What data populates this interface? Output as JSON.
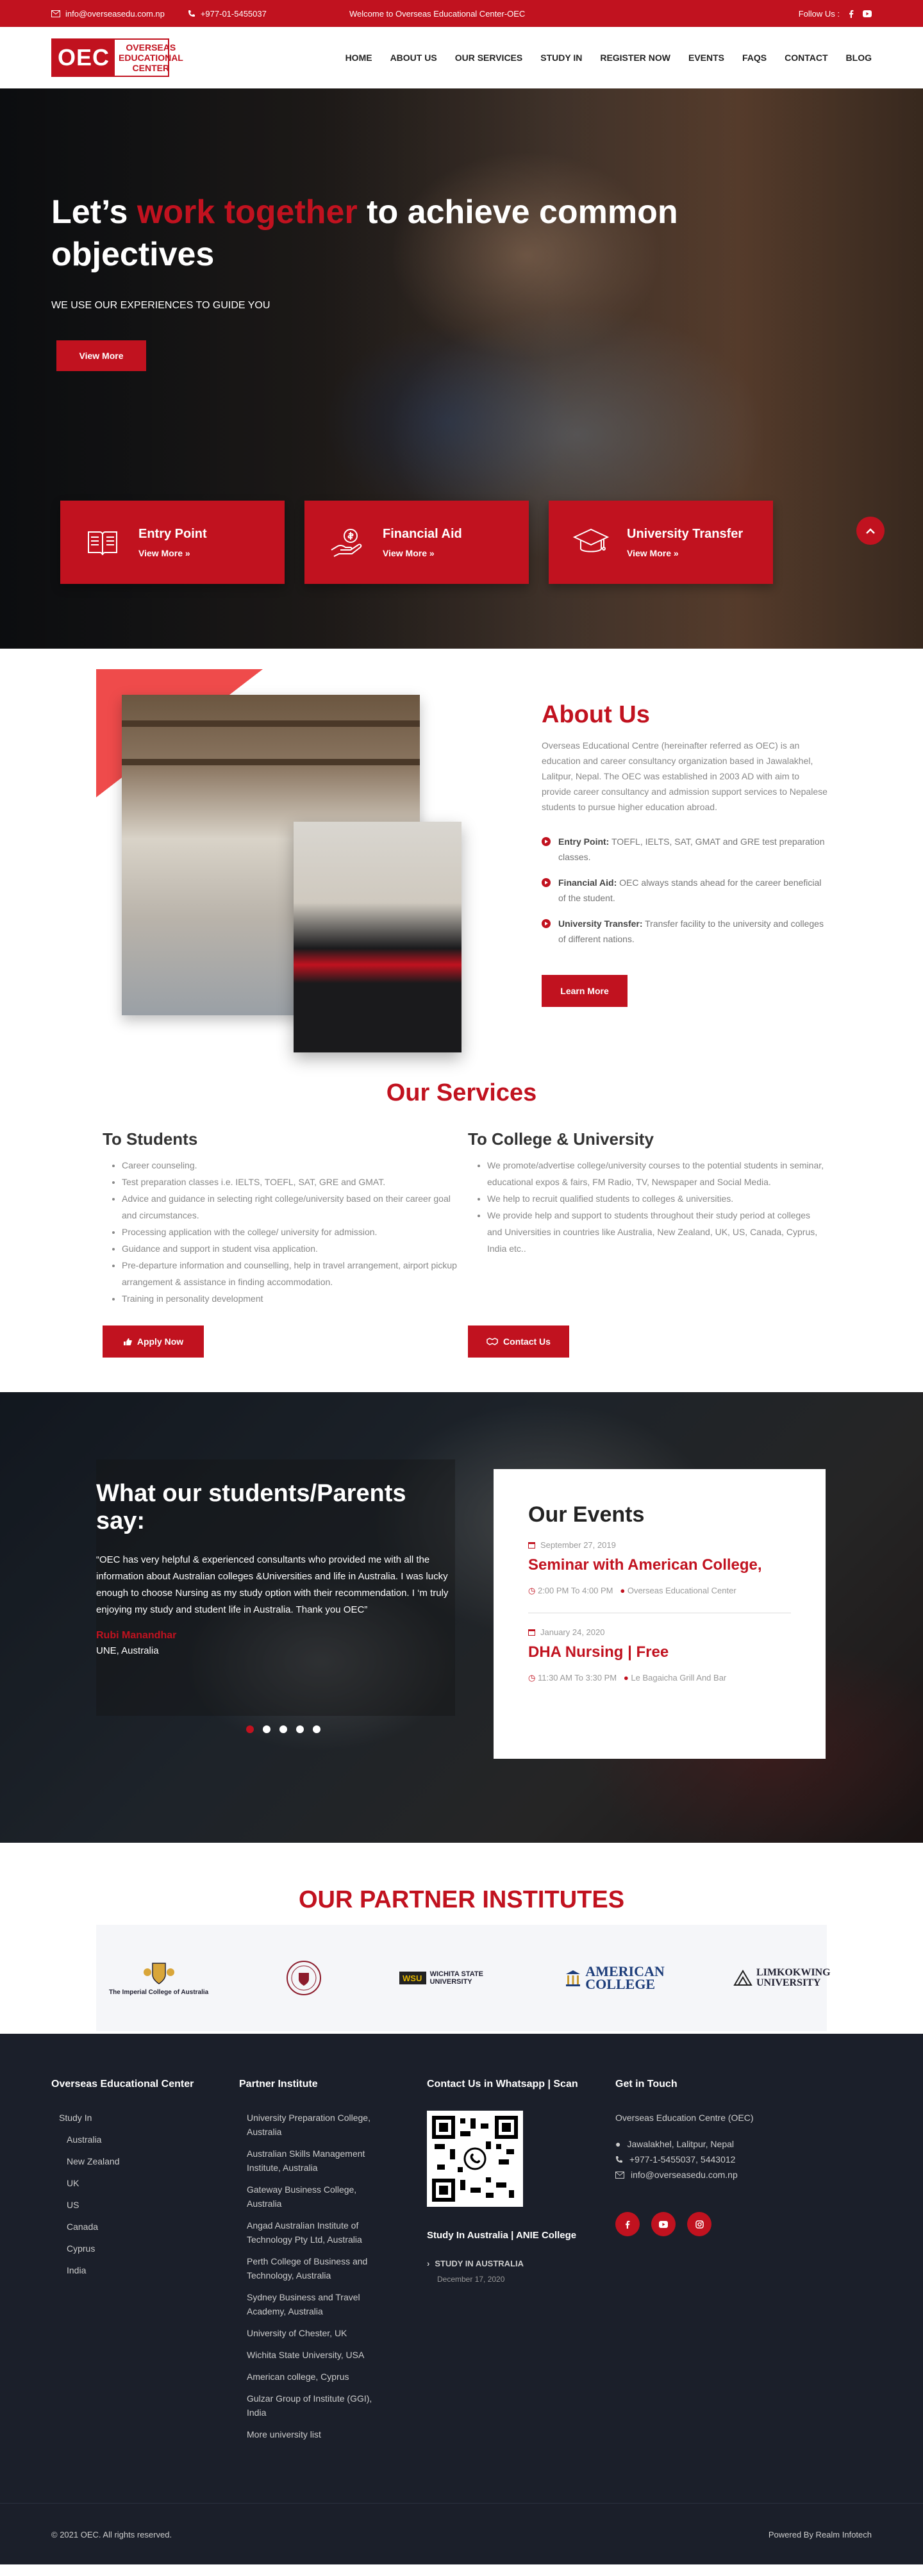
{
  "topbar": {
    "email": "info@overseasedu.com.np",
    "phone": "+977-01-5455037",
    "welcome": "Welcome to Overseas Educational Center-OEC",
    "follow": "Follow Us :"
  },
  "header": {
    "logo_short": "OEC",
    "logo_name": "OVERSEAS EDUCATIONAL CENTER",
    "nav": [
      "HOME",
      "ABOUT US",
      "OUR SERVICES",
      "STUDY IN",
      "REGISTER NOW",
      "EVENTS",
      "FAQS",
      "CONTACT",
      "BLOG"
    ]
  },
  "hero": {
    "title_pre": "Let’s ",
    "title_red": "work together",
    "title_post": " to achieve common objectives",
    "subtitle": "WE USE OUR EXPERIENCES TO GUIDE YOU",
    "button": "View More",
    "features": [
      {
        "title": "Entry Point",
        "more": "View More »",
        "icon": "book-icon"
      },
      {
        "title": "Financial Aid",
        "more": "View More »",
        "icon": "money-hand-icon"
      },
      {
        "title": "University Transfer",
        "more": "View More »",
        "icon": "graduation-cap-icon"
      }
    ]
  },
  "about": {
    "title": "About Us",
    "text": "Overseas Educational Centre (hereinafter referred as OEC) is an education and career consultancy organization based in Jawalakhel, Lalitpur, Nepal. The OEC was established in 2003 AD with aim to provide career consultancy and admission support services to Nepalese students to pursue higher education abroad.",
    "items": [
      {
        "label": "Entry Point:",
        "text": " TOEFL, IELTS, SAT, GMAT and GRE test preparation classes."
      },
      {
        "label": "Financial Aid:",
        "text": " OEC always stands ahead for the career beneficial of the student."
      },
      {
        "label": "University Transfer:",
        "text": " Transfer facility to the university and colleges of different nations."
      }
    ],
    "button": "Learn More"
  },
  "services": {
    "title": "Our Services",
    "students": {
      "heading": "To Students",
      "items": [
        "Career counseling.",
        "Test preparation classes i.e. IELTS, TOEFL, SAT, GRE and GMAT.",
        "Advice and guidance in selecting right college/university based on their career goal and circumstances.",
        "Processing application with the college/ university for admission.",
        "Guidance and support in student visa application.",
        "Pre-departure information and counselling, help in travel arrangement, airport pickup arrangement & assistance in finding accommodation.",
        "Training in personality development"
      ],
      "button": "Apply Now"
    },
    "colleges": {
      "heading": "To College & University",
      "items": [
        "We promote/advertise college/university courses to the potential students in seminar, educational expos & fairs, FM Radio, TV, Newspaper and Social Media.",
        "We help to recruit qualified students to colleges & universities.",
        "We provide help and support to students throughout their study period at colleges and Universities in countries like Australia, New Zealand, UK, US, Canada, Cyprus, India etc.."
      ],
      "button": "Contact Us"
    }
  },
  "testimonial": {
    "title": "What our students/Parents say:",
    "quote": "“OEC has very helpful & experienced consultants who provided me with all the information about Australian colleges &Universities and life in Australia. I was lucky enough to choose Nursing as my study option with their recommendation. I ‘m truly enjoying my study and student life in Australia. Thank you OEC”",
    "name": "Rubi Manandhar",
    "place": "UNE, Australia"
  },
  "events": {
    "title": "Our Events",
    "items": [
      {
        "date": "September 27, 2019",
        "title": "Seminar with American College,",
        "time": "2:00 PM To 4:00 PM",
        "venue": "Overseas Educational Center"
      },
      {
        "date": "January 24, 2020",
        "title": "DHA Nursing | Free",
        "time": "11:30 AM To 3:30 PM",
        "venue": "Le Bagaicha Grill And Bar"
      }
    ]
  },
  "partners": {
    "title": "OUR PARTNER INSTITUTES",
    "logos": [
      "The Imperial College of Australia",
      "",
      "WICHITA STATE UNIVERSITY",
      "AMERICAN COLLEGE",
      "LIMKOKWING UNIVERSITY"
    ]
  },
  "footer": {
    "col1": {
      "title": "Overseas Educational Center",
      "study_in": "Study In",
      "countries": [
        "Australia",
        "New Zealand",
        "UK",
        "US",
        "Canada",
        "Cyprus",
        "India"
      ]
    },
    "col2": {
      "title": "Partner Institute",
      "items": [
        "University Preparation College, Australia",
        "Australian Skills Management Institute, Australia",
        "Gateway Business College, Australia",
        "Angad Australian Institute of Technology Pty Ltd, Australia",
        "Perth College of Business and Technology, Australia",
        "Sydney Business and Travel Academy, Australia",
        "University of Chester, UK",
        "Wichita State University, USA",
        "American college, Cyprus",
        "Gulzar Group of Institute (GGI), India",
        "More university list"
      ]
    },
    "col3": {
      "title": "Contact Us in Whatsapp | Scan",
      "subtitle": "Study In Australia | ANIE College",
      "event_title": "STUDY IN AUSTRALIA",
      "event_date": "December 17, 2020"
    },
    "col4": {
      "title": "Get in Touch",
      "org": "Overseas Education Centre (OEC)",
      "address": "Jawalakhel, Lalitpur, Nepal",
      "phone": "+977-1-5455037, 5443012",
      "email": "info@overseasedu.com.np"
    },
    "copyright": "© 2021 OEC. All rights reserved.",
    "powered": "Powered By Realm Infotech"
  },
  "colors": {
    "brand": "#c1121f",
    "footer_bg": "#1b1f2a"
  }
}
